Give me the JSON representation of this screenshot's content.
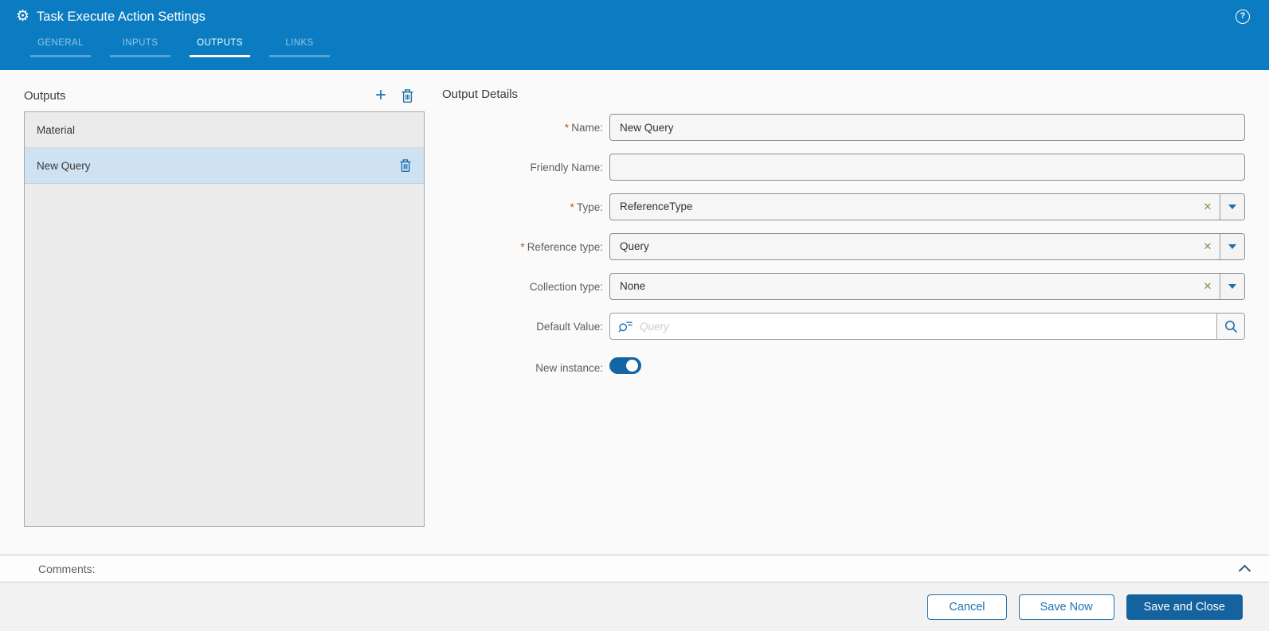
{
  "window": {
    "title": "Task Execute Action Settings"
  },
  "icons": {
    "gear": "⚙",
    "help": "?",
    "add": "+",
    "clear": "✕",
    "delete": "trash-outline",
    "dropdown": "triangle-down",
    "search": "magnifier",
    "query": "magnifier-with-lines",
    "collapse": "chevron-up"
  },
  "colors": {
    "header_blue": "#0b7cc1",
    "accent_blue": "#1d6fad",
    "selection_blue": "#cfe2f2",
    "primary_button_blue": "#15639e",
    "toggle_on_blue": "#1465a3",
    "required_orange": "#b05c20",
    "panel_gray": "#ececec",
    "footer_gray": "#f2f2f2"
  },
  "tabs": [
    {
      "label": "GENERAL",
      "active": false
    },
    {
      "label": "INPUTS",
      "active": false
    },
    {
      "label": "OUTPUTS",
      "active": true
    },
    {
      "label": "LINKS",
      "active": false
    }
  ],
  "outputs_panel": {
    "title": "Outputs",
    "items": [
      {
        "label": "Material",
        "selected": false
      },
      {
        "label": "New Query",
        "selected": true
      }
    ]
  },
  "details": {
    "title": "Output Details",
    "required_marker": "*",
    "fields": {
      "name": {
        "label": "Name:",
        "required": true,
        "value": "New Query"
      },
      "friendly_name": {
        "label": "Friendly Name:",
        "required": false,
        "value": ""
      },
      "type": {
        "label": "Type:",
        "required": true,
        "value": "ReferenceType"
      },
      "reference_type": {
        "label": "Reference type:",
        "required": true,
        "value": "Query"
      },
      "collection_type": {
        "label": "Collection type:",
        "required": false,
        "value": "None"
      },
      "default_value": {
        "label": "Default Value:",
        "value": "",
        "placeholder": "Query"
      },
      "new_instance": {
        "label": "New instance:",
        "on": true
      }
    }
  },
  "comments": {
    "label": "Comments:"
  },
  "footer": {
    "buttons": [
      {
        "label": "Cancel",
        "primary": false
      },
      {
        "label": "Save Now",
        "primary": false
      },
      {
        "label": "Save and Close",
        "primary": true
      }
    ]
  }
}
